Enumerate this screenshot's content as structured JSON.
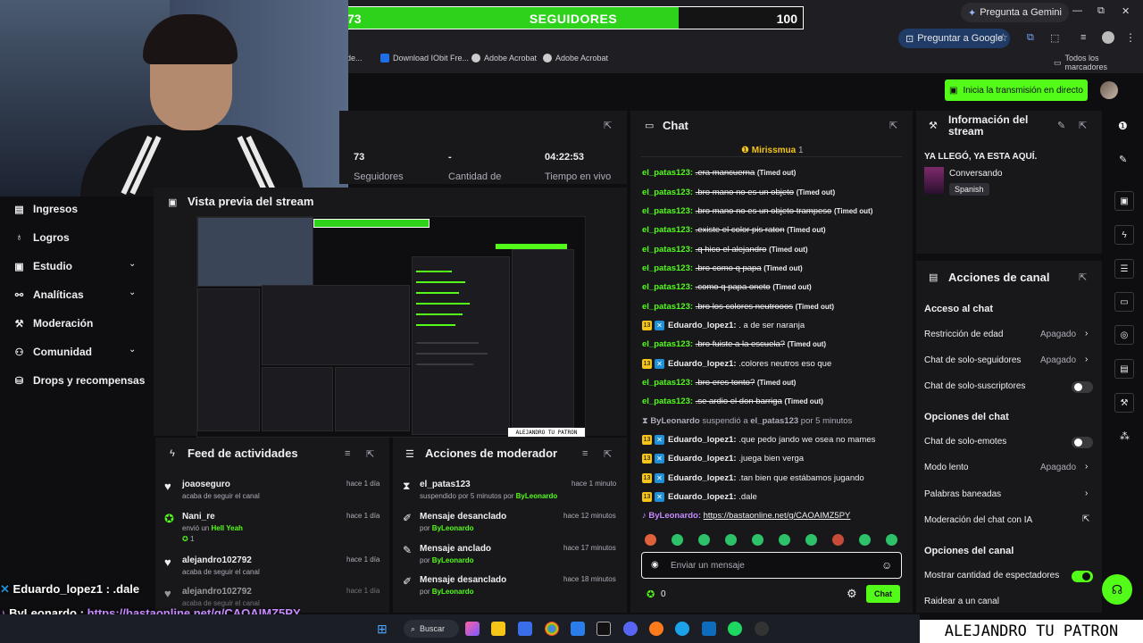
{
  "overlay": {
    "followers_current": "73",
    "followers_goal": "100",
    "followers_label": "SEGUIDORES",
    "progress_fraction": 0.73,
    "ticker_line1_user": "Eduardo_lopez1",
    "ticker_line1_msg": ": .dale",
    "ticker_line2_user": "ByLeonardo",
    "ticker_line2_sep": ":",
    "ticker_line2_link": "https://bastaonline.net/g/CAOAIMZ5PY",
    "watermark": "ALEJANDRO TU PATRON"
  },
  "browser": {
    "gemini": "Pregunta a Gemini",
    "ask_google": "Preguntar a Google",
    "bookmarks": [
      "de...",
      "Download IObit Fre...",
      "Adobe Acrobat",
      "Adobe Acrobat"
    ],
    "all_bookmarks": "Todos los marcadores",
    "win_min": "—",
    "win_max": "⧉",
    "win_close": "✕"
  },
  "header": {
    "live_button": "Inicia la transmisión en directo"
  },
  "sidebar": {
    "items": [
      {
        "label": "Ingresos",
        "icon": "▤"
      },
      {
        "label": "Logros",
        "icon": "♁"
      },
      {
        "label": "Estudio",
        "icon": "▣"
      },
      {
        "label": "Analíticas",
        "icon": "⚯"
      },
      {
        "label": "Moderación",
        "icon": "⚒"
      },
      {
        "label": "Comunidad",
        "icon": "⚇"
      },
      {
        "label": "Drops y recompensas",
        "icon": "⛁"
      }
    ],
    "chevron": "⌄"
  },
  "stats": {
    "followers_value": "73",
    "followers_label": "Seguidores",
    "qty_value": "-",
    "qty_label": "Cantidad de",
    "time_value": "04:22:53",
    "time_label": "Tiempo en vivo"
  },
  "preview": {
    "title": "Vista previa del stream",
    "inner_watermark": "ALEJANDRO TU PATRON"
  },
  "feed": {
    "title": "Feed de actividades",
    "items": [
      {
        "name": "joaoseguro",
        "sub": "acaba de seguir el canal",
        "time": "hace 1 día",
        "icon": "♥"
      },
      {
        "name": "Nani_re",
        "sub_pre": "envió un ",
        "sub_hl": "Hell Yeah",
        "count": "1",
        "time": "hace 1 día",
        "icon": "✪"
      },
      {
        "name": "alejandro102792",
        "sub": "acaba de seguir el canal",
        "time": "hace 1 día",
        "icon": "♥"
      },
      {
        "name": "alejandro102792",
        "sub": "acaba de seguir el canal",
        "time": "hace 1 día",
        "icon": "♥"
      }
    ]
  },
  "modactions": {
    "title": "Acciones de moderador",
    "items": [
      {
        "name": "el_patas123",
        "sub_pre": "suspendido por 5 minutos por ",
        "by": "ByLeonardo",
        "time": "hace 1 minuto",
        "icon": "⧗"
      },
      {
        "name": "Mensaje desanclado",
        "sub_pre": "por ",
        "by": "ByLeonardo",
        "time": "hace 12 minutos",
        "icon": "✐"
      },
      {
        "name": "Mensaje anclado",
        "sub_pre": "por ",
        "by": "ByLeonardo",
        "time": "hace 17 minutos",
        "icon": "✎"
      },
      {
        "name": "Mensaje desanclado",
        "sub_pre": "por ",
        "by": "ByLeonardo",
        "time": "hace 18 minutos",
        "icon": "✐"
      }
    ]
  },
  "chat": {
    "title": "Chat",
    "pinned_user": "Mirissmua",
    "pinned_count": "1",
    "timed_out": "(Timed out)",
    "messages": [
      {
        "user": "el_patas123:",
        "text": ".era mancuerna",
        "to": true
      },
      {
        "user": "el_patas123:",
        "text": ".bro mano no es un objeto",
        "to": true
      },
      {
        "user": "el_patas123:",
        "text": ".bro mano no es un objeto trampeso",
        "to": true
      },
      {
        "user": "el_patas123:",
        "text": ".existe el color pis raton",
        "to": true
      },
      {
        "user": "el_patas123:",
        "text": ".q hico el alejandro",
        "to": true
      },
      {
        "user": "el_patas123:",
        "text": ".bro como q papa",
        "to": true
      },
      {
        "user": "el_patas123:",
        "text": ".como q papa oneto",
        "to": true
      },
      {
        "user": "el_patas123:",
        "text": ".bro los colores neutrooos",
        "to": true
      },
      {
        "user": "Eduardo_lopez1:",
        "text": ". a de ser naranja",
        "to": false,
        "badge": "13"
      },
      {
        "user": "el_patas123:",
        "text": ".bro fuiste a la escuela?",
        "to": true
      },
      {
        "user": "Eduardo_lopez1:",
        "text": ".colores neutros eso que",
        "to": false,
        "badge": "13"
      },
      {
        "user": "el_patas123:",
        "text": ".bro eres tonto?",
        "to": true
      },
      {
        "user": "el_patas123:",
        "text": ".se ardio el don barriga",
        "to": true
      }
    ],
    "system_by": "ByLeonardo",
    "system_mid": " suspendió a ",
    "system_target": "el_patas123",
    "system_end": " por 5 minutos",
    "messages2": [
      {
        "user": "Eduardo_lopez1:",
        "text": ".que pedo jando we osea no mames"
      },
      {
        "user": "Eduardo_lopez1:",
        "text": ".juega bien verga"
      },
      {
        "user": "Eduardo_lopez1:",
        "text": ".tan bien que estábamos jugando"
      },
      {
        "user": "Eduardo_lopez1:",
        "text": ".dale"
      }
    ],
    "badge": "13",
    "last_user": "ByLeonardo:",
    "last_link": "https://bastaonline.net/g/CAOAIMZ5PY",
    "input_placeholder": "Enviar un mensaje",
    "points": "0",
    "send_label": "Chat"
  },
  "info": {
    "title": "Información del stream",
    "stream_title": "YA LLEGÓ, YA ESTA AQUÍ.",
    "category": "Conversando",
    "language": "Spanish"
  },
  "channel": {
    "title": "Acciones de canal",
    "chat_access": "Acceso al chat",
    "age_restriction": "Restricción de edad",
    "followers_only": "Chat de solo-seguidores",
    "subs_only": "Chat de solo-suscriptores",
    "off": "Apagado",
    "chat_options": "Opciones del chat",
    "emotes_only": "Chat de solo-emotes",
    "slow_mode": "Modo lento",
    "banned_words": "Palabras baneadas",
    "ai_moderation": "Moderación del chat con IA",
    "channel_options": "Opciones del canal",
    "show_viewers": "Mostrar cantidad de espectadores",
    "raid": "Raidear a un canal"
  },
  "taskbar": {
    "search": "Buscar"
  },
  "colors": {
    "accent": "#53fc18",
    "panel": "#18181b",
    "background": "#0e0e10"
  }
}
